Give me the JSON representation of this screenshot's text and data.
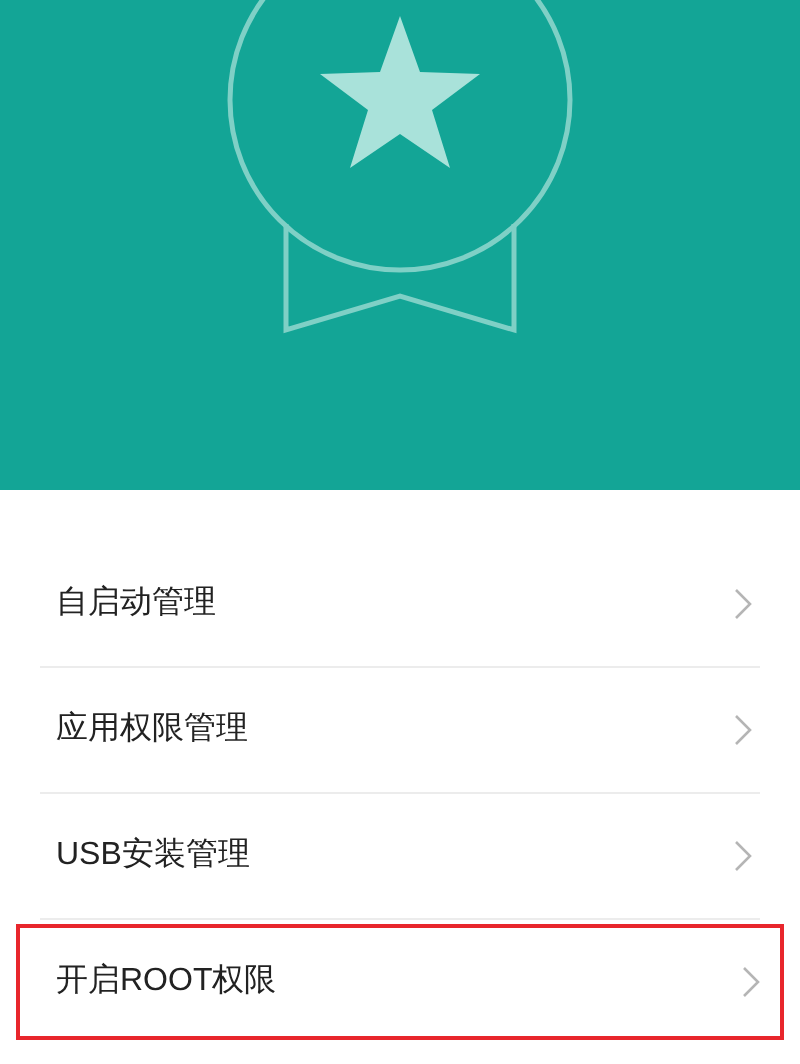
{
  "items": [
    {
      "label": "自启动管理",
      "highlighted": false
    },
    {
      "label": "应用权限管理",
      "highlighted": false
    },
    {
      "label": "USB安装管理",
      "highlighted": false
    },
    {
      "label": "开启ROOT权限",
      "highlighted": true
    }
  ]
}
